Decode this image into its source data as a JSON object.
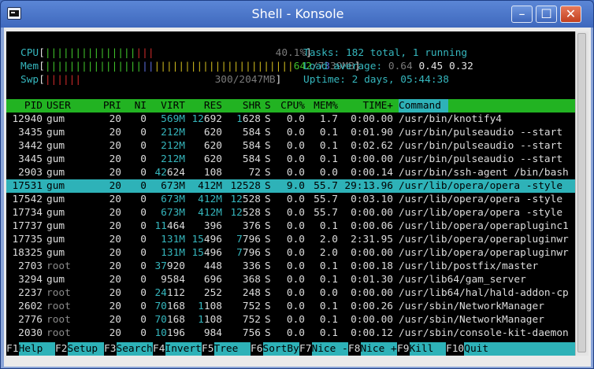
{
  "window": {
    "title": "Shell - Konsole",
    "minimize_glyph": "–",
    "maximize_glyph": "☐",
    "close_glyph": "✕",
    "icon": "terminal-icon"
  },
  "meters": {
    "cpu": {
      "label": "CPU",
      "bars": "|||||||||||||||",
      "bars_red": "|||",
      "value": "40.1%"
    },
    "mem": {
      "label": "Mem",
      "bars_green": "||||||||||||||||",
      "bars_blue": "||",
      "bars_yellow": "|||||||||||||||||||||||",
      "used": "642",
      "total_a": "/7",
      "total_b": "39MB"
    },
    "swp": {
      "label": "Swp",
      "bars": "||||||",
      "value": "300/2047MB"
    }
  },
  "stats": {
    "tasks_label": "Tasks:",
    "tasks_total": "182",
    "tasks_total_word": "total,",
    "tasks_running": "1",
    "tasks_running_word": "running",
    "load_label": "Load average:",
    "load1": "0.64",
    "load5": "0.45",
    "load15": "0.32",
    "uptime_label": "Uptime:",
    "uptime": "2 days, 05:44:38"
  },
  "columns": [
    "PID",
    "USER",
    "PRI",
    "NI",
    "VIRT",
    "RES",
    "SHR",
    "S",
    "CPU%",
    "MEM%",
    "TIME+",
    "Command"
  ],
  "processes": [
    {
      "pid": "12940",
      "user": "gum",
      "pri": "20",
      "ni": "0",
      "virt_a": "",
      "virt_b": "569M",
      "res_a": "12",
      "res_b": "692",
      "shr_a": "1",
      "shr_b": "628",
      "s": "S",
      "cpu": "0.0",
      "mem": "1.7",
      "time": "0:00.00",
      "cmd": "/usr/bin/knotify4"
    },
    {
      "pid": "3435",
      "user": "gum",
      "pri": "20",
      "ni": "0",
      "virt_a": "",
      "virt_b": "212M",
      "res_a": "",
      "res_b": "620",
      "shr_a": "",
      "shr_b": "584",
      "s": "S",
      "cpu": "0.0",
      "mem": "0.1",
      "time": "0:01.90",
      "cmd": "/usr/bin/pulseaudio --start"
    },
    {
      "pid": "3442",
      "user": "gum",
      "pri": "20",
      "ni": "0",
      "virt_a": "",
      "virt_b": "212M",
      "res_a": "",
      "res_b": "620",
      "shr_a": "",
      "shr_b": "584",
      "s": "S",
      "cpu": "0.0",
      "mem": "0.1",
      "time": "0:02.62",
      "cmd": "/usr/bin/pulseaudio --start"
    },
    {
      "pid": "3445",
      "user": "gum",
      "pri": "20",
      "ni": "0",
      "virt_a": "",
      "virt_b": "212M",
      "res_a": "",
      "res_b": "620",
      "shr_a": "",
      "shr_b": "584",
      "s": "S",
      "cpu": "0.0",
      "mem": "0.1",
      "time": "0:00.00",
      "cmd": "/usr/bin/pulseaudio --start"
    },
    {
      "pid": "2903",
      "user": "gum",
      "pri": "20",
      "ni": "0",
      "virt_a": "42",
      "virt_b": "624",
      "res_a": "",
      "res_b": "108",
      "shr_a": "",
      "shr_b": "72",
      "s": "S",
      "cpu": "0.0",
      "mem": "0.0",
      "time": "0:00.14",
      "cmd": "/usr/bin/ssh-agent /bin/bash"
    },
    {
      "pid": "17531",
      "user": "gum",
      "pri": "20",
      "ni": "0",
      "virt_a": "",
      "virt_b": "673M",
      "res_a": "",
      "res_b": "412M",
      "shr_a": "12",
      "shr_b": "528",
      "s": "S",
      "cpu": "9.0",
      "mem": "55.7",
      "time": "29:13.96",
      "cmd": "/usr/lib/opera/opera -style",
      "selected": true
    },
    {
      "pid": "17542",
      "user": "gum",
      "pri": "20",
      "ni": "0",
      "virt_a": "",
      "virt_b": "673M",
      "res_a": "",
      "res_b": "412M",
      "shr_a": "12",
      "shr_b": "528",
      "s": "S",
      "cpu": "0.0",
      "mem": "55.7",
      "time": "0:03.10",
      "cmd": "/usr/lib/opera/opera -style"
    },
    {
      "pid": "17734",
      "user": "gum",
      "pri": "20",
      "ni": "0",
      "virt_a": "",
      "virt_b": "673M",
      "res_a": "",
      "res_b": "412M",
      "shr_a": "12",
      "shr_b": "528",
      "s": "S",
      "cpu": "0.0",
      "mem": "55.7",
      "time": "0:00.00",
      "cmd": "/usr/lib/opera/opera -style"
    },
    {
      "pid": "17737",
      "user": "gum",
      "pri": "20",
      "ni": "0",
      "virt_a": "11",
      "virt_b": "464",
      "res_a": "",
      "res_b": "396",
      "shr_a": "",
      "shr_b": "376",
      "s": "S",
      "cpu": "0.0",
      "mem": "0.1",
      "time": "0:00.06",
      "cmd": "/usr/lib/opera/operapluginc1"
    },
    {
      "pid": "17735",
      "user": "gum",
      "pri": "20",
      "ni": "0",
      "virt_a": "",
      "virt_b": "131M",
      "res_a": "15",
      "res_b": "496",
      "shr_a": "7",
      "shr_b": "796",
      "s": "S",
      "cpu": "0.0",
      "mem": "2.0",
      "time": "2:31.95",
      "cmd": "/usr/lib/opera/operapluginwr"
    },
    {
      "pid": "18325",
      "user": "gum",
      "pri": "20",
      "ni": "0",
      "virt_a": "",
      "virt_b": "131M",
      "res_a": "15",
      "res_b": "496",
      "shr_a": "7",
      "shr_b": "796",
      "s": "S",
      "cpu": "0.0",
      "mem": "2.0",
      "time": "0:00.00",
      "cmd": "/usr/lib/opera/operapluginwr"
    },
    {
      "pid": "2703",
      "user": "root",
      "pri": "20",
      "ni": "0",
      "virt_a": "37",
      "virt_b": "920",
      "res_a": "",
      "res_b": "448",
      "shr_a": "",
      "shr_b": "336",
      "s": "S",
      "cpu": "0.0",
      "mem": "0.1",
      "time": "0:00.18",
      "cmd": "/usr/lib/postfix/master"
    },
    {
      "pid": "3294",
      "user": "gum",
      "pri": "20",
      "ni": "0",
      "virt_a": "",
      "virt_b": "9584",
      "res_a": "",
      "res_b": "696",
      "shr_a": "",
      "shr_b": "368",
      "s": "S",
      "cpu": "0.0",
      "mem": "0.1",
      "time": "0:01.30",
      "cmd": "/usr/lib64/gam_server"
    },
    {
      "pid": "2237",
      "user": "root",
      "pri": "20",
      "ni": "0",
      "virt_a": "24",
      "virt_b": "112",
      "res_a": "",
      "res_b": "252",
      "shr_a": "",
      "shr_b": "248",
      "s": "S",
      "cpu": "0.0",
      "mem": "0.0",
      "time": "0:00.00",
      "cmd": "/usr/lib64/hal/hald-addon-cp"
    },
    {
      "pid": "2602",
      "user": "root",
      "pri": "20",
      "ni": "0",
      "virt_a": "70",
      "virt_b": "168",
      "res_a": "1",
      "res_b": "108",
      "shr_a": "",
      "shr_b": "752",
      "s": "S",
      "cpu": "0.0",
      "mem": "0.1",
      "time": "0:00.26",
      "cmd": "/usr/sbin/NetworkManager"
    },
    {
      "pid": "2776",
      "user": "root",
      "pri": "20",
      "ni": "0",
      "virt_a": "70",
      "virt_b": "168",
      "res_a": "1",
      "res_b": "108",
      "shr_a": "",
      "shr_b": "752",
      "s": "S",
      "cpu": "0.0",
      "mem": "0.1",
      "time": "0:00.00",
      "cmd": "/usr/sbin/NetworkManager"
    },
    {
      "pid": "2030",
      "user": "root",
      "pri": "20",
      "ni": "0",
      "virt_a": "10",
      "virt_b": "196",
      "res_a": "",
      "res_b": "984",
      "shr_a": "",
      "shr_b": "756",
      "s": "S",
      "cpu": "0.0",
      "mem": "0.1",
      "time": "0:00.12",
      "cmd": "/usr/sbin/console-kit-daemon"
    }
  ],
  "function_keys": [
    {
      "key": "F1",
      "label": "Help  "
    },
    {
      "key": "F2",
      "label": "Setup "
    },
    {
      "key": "F3",
      "label": "Search"
    },
    {
      "key": "F4",
      "label": "Invert"
    },
    {
      "key": "F5",
      "label": "Tree  "
    },
    {
      "key": "F6",
      "label": "SortBy"
    },
    {
      "key": "F7",
      "label": "Nice -"
    },
    {
      "key": "F8",
      "label": "Nice +"
    },
    {
      "key": "F9",
      "label": "Kill  "
    },
    {
      "key": "F10",
      "label": "Quit  "
    }
  ],
  "colors": {
    "titlebar": "#3e68bd",
    "header": "#22b322",
    "selection": "#2eb2b8",
    "cyan": "#35b6bd",
    "green": "#3fc12a",
    "red": "#cc2a2a",
    "blue": "#5a6ad8"
  }
}
